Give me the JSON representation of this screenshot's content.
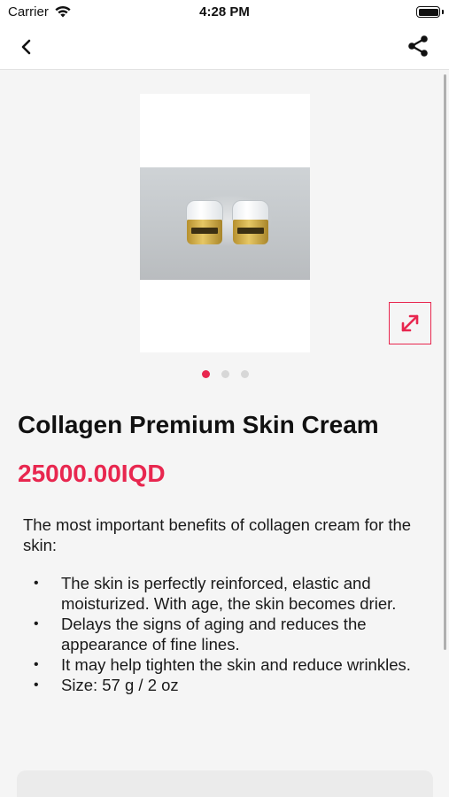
{
  "status_bar": {
    "carrier": "Carrier",
    "time": "4:28 PM"
  },
  "nav": {
    "back_icon": "chevron-left-icon",
    "share_icon": "share-icon"
  },
  "gallery": {
    "image_count": 3,
    "active_index": 0,
    "zoom_icon": "expand-arrows-icon"
  },
  "product": {
    "title": "Collagen Premium Skin Cream",
    "price": "25000.00IQD",
    "description_intro": "The most important benefits of collagen cream for the skin:",
    "benefits": [
      "The skin is perfectly reinforced, elastic and moisturized. With age, the skin becomes drier.",
      "Delays the signs of aging and reduces the appearance of fine lines.",
      "It may help tighten the skin and reduce wrinkles.",
      "Size: 57 g / 2 oz"
    ]
  },
  "colors": {
    "accent": "#e8274f",
    "background": "#f5f5f5",
    "header": "#ffffff"
  }
}
